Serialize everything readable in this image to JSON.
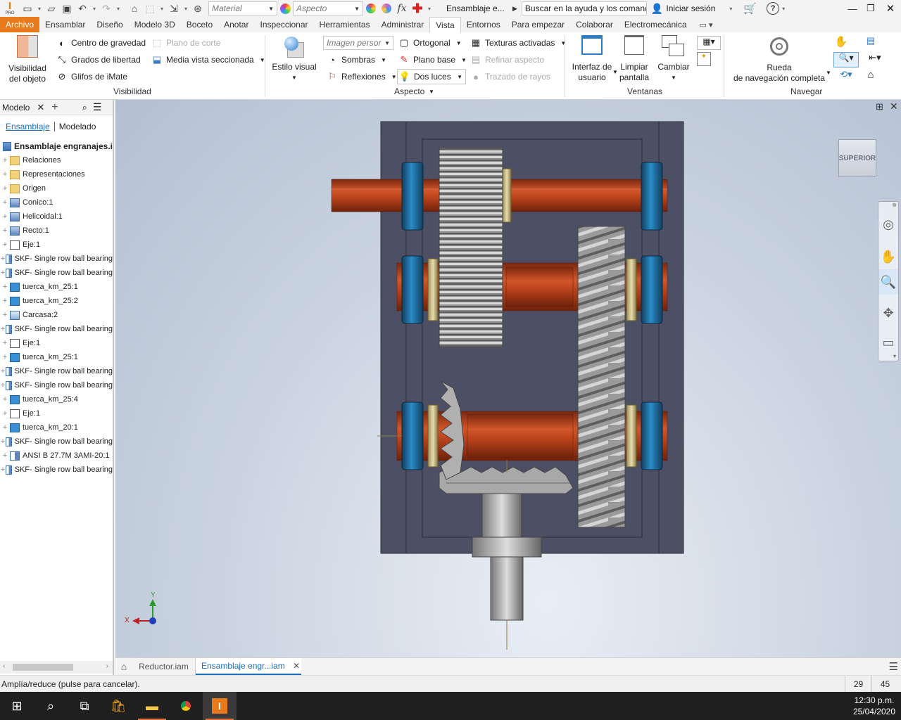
{
  "app": {
    "logo_text": "I",
    "logo_sub": "PRO",
    "material_placeholder": "Material",
    "aspect_placeholder": "Aspecto",
    "fx_label": "fx",
    "doc_title": "Ensamblaje e...",
    "search_placeholder": "Buscar en la ayuda y los comand",
    "signin_label": "Iniciar sesión",
    "help_label": "?"
  },
  "tabs": [
    "Archivo",
    "Ensamblar",
    "Diseño",
    "Modelo 3D",
    "Boceto",
    "Anotar",
    "Inspeccionar",
    "Herramientas",
    "Administrar",
    "Vista",
    "Entornos",
    "Para empezar",
    "Colaborar",
    "Electromecánica"
  ],
  "ribbon": {
    "visibilidad": {
      "big_label_1": "Visibilidad",
      "big_label_2": "del objeto",
      "items": [
        "Centro de gravedad",
        "Grados de libertad",
        "Glifos de iMate"
      ],
      "items2": [
        "Plano de corte",
        "Media vista seccionada"
      ],
      "panel_label": "Visibilidad"
    },
    "aspecto": {
      "estilo_visual": "Estilo visual",
      "imagen_placeholder": "Imagen persor",
      "sombras": "Sombras",
      "reflexiones": "Reflexiones",
      "ortogonal": "Ortogonal",
      "plano_base": "Plano base",
      "dos_luces": "Dos luces",
      "texturas": "Texturas activadas",
      "refinar": "Refinar aspecto",
      "trazado": "Trazado de rayos",
      "panel_label": "Aspecto"
    },
    "ventanas": {
      "interfaz_1": "Interfaz de",
      "interfaz_2": "usuario",
      "limpiar_1": "Limpiar",
      "limpiar_2": "pantalla",
      "cambiar": "Cambiar",
      "panel_label": "Ventanas"
    },
    "navegar": {
      "rueda_1": "Rueda",
      "rueda_2": "de navegación completa",
      "panel_label": "Navegar"
    }
  },
  "browser": {
    "title": "Modelo",
    "tab_ensamblaje": "Ensamblaje",
    "tab_modelado": "Modelado",
    "root": "Ensamblaje engranajes.i",
    "items": [
      {
        "label": "Relaciones",
        "icon": "folder-icon"
      },
      {
        "label": "Representaciones",
        "icon": "folder-icon"
      },
      {
        "label": "Origen",
        "icon": "folder-icon"
      },
      {
        "label": "Conico:1",
        "icon": "assembly-icon"
      },
      {
        "label": "Helicoidal:1",
        "icon": "assembly-icon"
      },
      {
        "label": "Recto:1",
        "icon": "assembly-icon"
      },
      {
        "label": "Eje:1",
        "icon": "shaft-icon"
      },
      {
        "label": "SKF- Single row ball bearing",
        "icon": "bearing-icon"
      },
      {
        "label": "SKF- Single row ball bearing",
        "icon": "bearing-icon"
      },
      {
        "label": "tuerca_km_25:1",
        "icon": "part-icon"
      },
      {
        "label": "tuerca_km_25:2",
        "icon": "part-icon"
      },
      {
        "label": "Carcasa:2",
        "icon": "housing-icon"
      },
      {
        "label": "SKF- Single row ball bearing",
        "icon": "bearing-icon"
      },
      {
        "label": "Eje:1",
        "icon": "shaft-icon"
      },
      {
        "label": "tuerca_km_25:1",
        "icon": "part-icon"
      },
      {
        "label": "SKF- Single row ball bearing",
        "icon": "bearing-icon"
      },
      {
        "label": "SKF- Single row ball bearing",
        "icon": "bearing-icon"
      },
      {
        "label": "tuerca_km_25:4",
        "icon": "part-icon"
      },
      {
        "label": "Eje:1",
        "icon": "shaft-icon"
      },
      {
        "label": "tuerca_km_20:1",
        "icon": "part-icon"
      },
      {
        "label": "SKF- Single row ball bearing",
        "icon": "bearing-icon"
      },
      {
        "label": "ANSI B 27.7M 3AMI-20:1",
        "icon": "bearing-icon"
      },
      {
        "label": "SKF- Single row ball bearing",
        "icon": "bearing-icon"
      }
    ]
  },
  "viewport": {
    "viewcube_label": "SUPERIOR",
    "axis_x": "X",
    "axis_y": "Y"
  },
  "doc_tabs": [
    {
      "label": "Reductor.iam",
      "active": false
    },
    {
      "label": "Ensamblaje engr...iam",
      "active": true
    }
  ],
  "status": {
    "message": "Amplía/reduce (pulse para cancelar).",
    "num1": "29",
    "num2": "45"
  },
  "taskbar": {
    "time": "12:30 p.m.",
    "date": "25/04/2020"
  },
  "colors": {
    "file_tab": "#e87a1c",
    "housing": "#4d5065",
    "shaft": "#b5401a",
    "bearing": "#1f6fa0",
    "accent": "#1a6fc0"
  }
}
